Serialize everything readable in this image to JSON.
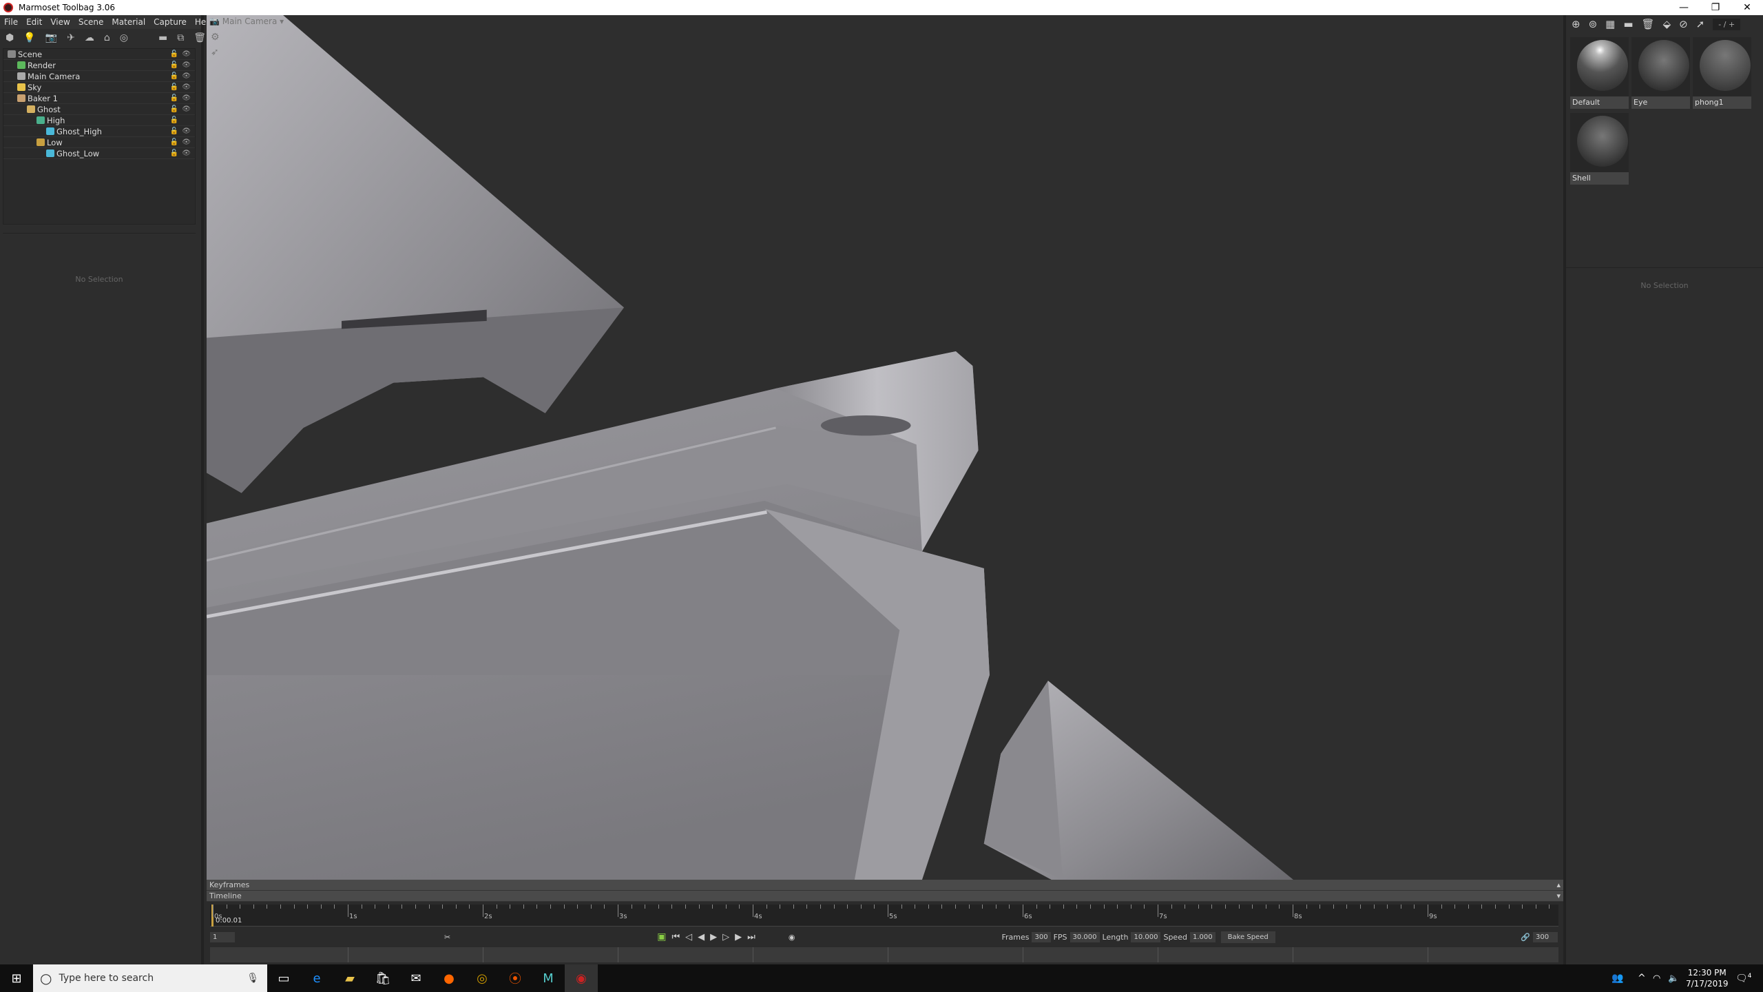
{
  "window": {
    "title": "Marmoset Toolbag 3.06",
    "min": "—",
    "max": "❐",
    "close": "✕"
  },
  "menu": [
    "File",
    "Edit",
    "View",
    "Scene",
    "Material",
    "Capture",
    "Help"
  ],
  "scene_tree": [
    {
      "label": "Scene",
      "depth": 0,
      "color": "#888",
      "eye": true
    },
    {
      "label": "Render",
      "depth": 1,
      "color": "#5cb85c",
      "eye": true
    },
    {
      "label": "Main Camera",
      "depth": 1,
      "color": "#aaa",
      "eye": true
    },
    {
      "label": "Sky",
      "depth": 1,
      "color": "#e8c24a",
      "eye": true
    },
    {
      "label": "Baker 1",
      "depth": 1,
      "color": "#c8a070",
      "eye": true
    },
    {
      "label": "Ghost",
      "depth": 2,
      "color": "#d4b060",
      "eye": true
    },
    {
      "label": "High",
      "depth": 3,
      "color": "#4ab08c",
      "eye": false
    },
    {
      "label": "Ghost_High",
      "depth": 4,
      "color": "#4ab8d8",
      "eye": true
    },
    {
      "label": "Low",
      "depth": 3,
      "color": "#c8a040",
      "eye": true
    },
    {
      "label": "Ghost_Low",
      "depth": 4,
      "color": "#4ab8d8",
      "eye": true
    }
  ],
  "left_props": {
    "empty": "No Selection"
  },
  "viewport": {
    "camera": "Main Camera ▾"
  },
  "materials": {
    "page": "- / +",
    "items": [
      {
        "name": "Default",
        "style": "radial-gradient(circle at 45% 20%,#fff 0,#bbb 10%,#555 45%,#222 100%)"
      },
      {
        "name": "Eye",
        "style": "radial-gradient(circle at 50% 40%,#777 0,#444 55%,#1a1a1a 100%)"
      },
      {
        "name": "phong1",
        "style": "radial-gradient(circle at 50% 30%,#777 0,#4a4a4a 60%,#2a2a2a 100%)"
      },
      {
        "name": "Shell",
        "style": "radial-gradient(circle at 50% 40%,#777 0,#444 55%,#1a1a1a 100%)"
      }
    ]
  },
  "right_props": {
    "empty": "No Selection"
  },
  "timeline": {
    "keyframes": "Keyframes",
    "timeline": "Timeline",
    "seconds": [
      "0s",
      "1s",
      "2s",
      "3s",
      "4s",
      "5s",
      "6s",
      "7s",
      "8s",
      "9s"
    ],
    "current_time": "0:00.01",
    "current_frame": "1",
    "frames_label": "Frames",
    "frames": "300",
    "fps_label": "FPS",
    "fps": "30.000",
    "length_label": "Length",
    "length": "10.000",
    "speed_label": "Speed",
    "speed": "1.000",
    "bake_speed": "Bake Speed",
    "end_frame": "300"
  },
  "taskbar": {
    "search_placeholder": "Type here to search",
    "time": "12:30 PM",
    "date": "7/17/2019",
    "notifications": "4"
  }
}
